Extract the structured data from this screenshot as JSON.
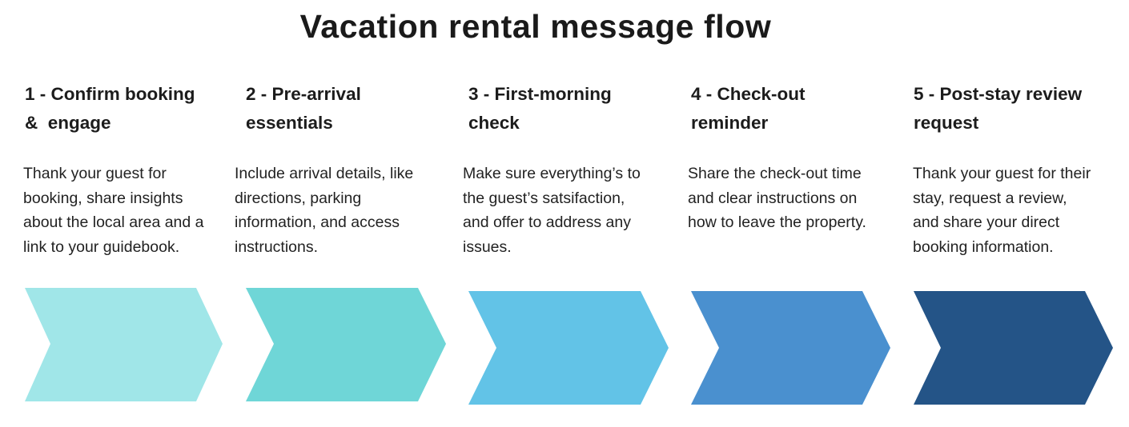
{
  "title": "Vacation rental message flow",
  "steps": [
    {
      "number": "1",
      "heading": "1 - Confirm booking\n&  engage",
      "body": "Thank your guest for\nbooking, share insights\nabout the local area and a\nlink to your guidebook.",
      "color": "#a0e6e8"
    },
    {
      "number": "2",
      "heading": "2 - Pre-arrival\nessentials",
      "body": "Include arrival details, like\ndirections, parking\ninformation, and access\ninstructions.",
      "color": "#6fd6d7"
    },
    {
      "number": "3",
      "heading": "3 - First-morning\ncheck",
      "body": "Make sure everything’s to\nthe guest’s satsifaction,\nand offer to address any\nissues.",
      "color": "#62c3e7"
    },
    {
      "number": "4",
      "heading": "4 - Check-out\nreminder",
      "body": "Share the check-out time\nand clear instructions on\nhow to leave the property.",
      "color": "#4a90cf"
    },
    {
      "number": "5",
      "heading": "5 - Post-stay review\nrequest",
      "body": "Thank your guest for their\nstay, request a review,\nand share your direct\nbooking information.",
      "color": "#245487"
    }
  ]
}
